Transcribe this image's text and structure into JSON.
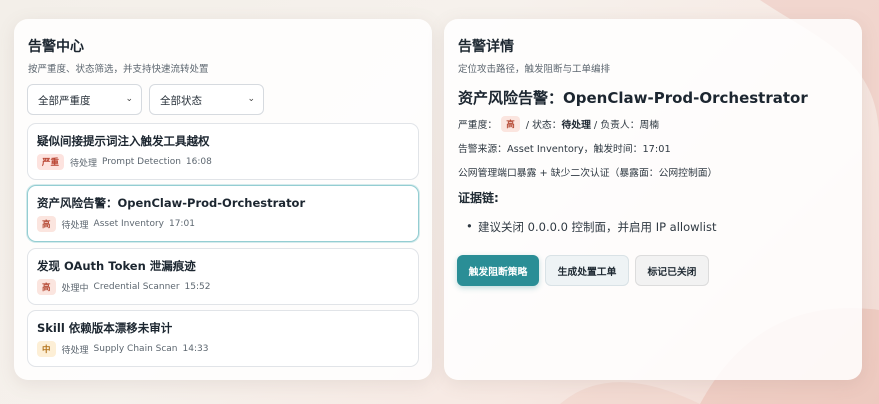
{
  "alert_center": {
    "title": "告警中心",
    "subtitle": "按严重度、状态筛选，并支持快速流转处置",
    "filters": {
      "severity": "全部严重度",
      "status": "全部状态"
    },
    "alerts": [
      {
        "title": "疑似间接提示词注入触发工具越权",
        "severity": "严重",
        "status": "待处理",
        "source": "Prompt Detection",
        "time": "16:08"
      },
      {
        "title": "资产风险告警：OpenClaw-Prod-Orchestrator",
        "severity": "高",
        "status": "待处理",
        "source": "Asset Inventory",
        "time": "17:01"
      },
      {
        "title": "发现 OAuth Token 泄漏痕迹",
        "severity": "高",
        "status": "处理中",
        "source": "Credential Scanner",
        "time": "15:52"
      },
      {
        "title": "Skill 依赖版本漂移未审计",
        "severity": "中",
        "status": "待处理",
        "source": "Supply Chain Scan",
        "time": "14:33"
      }
    ]
  },
  "detail": {
    "title": "告警详情",
    "subtitle": "定位攻击路径，触发阻断与工单编排",
    "heading": "资产风险告警：OpenClaw-Prod-Orchestrator",
    "severity_label": "严重度：",
    "severity": "高",
    "status_label": "/ 状态：",
    "status": "待处理",
    "owner_label": "/ 负责人：",
    "owner": "周楠",
    "source_line": "告警来源：Asset Inventory，触发时间：17:01",
    "description": "公网管理端口暴露 + 缺少二次认证（暴露面：公网控制面）",
    "evidence_title": "证据链:",
    "evidence": [
      "建议关闭 0.0.0.0 控制面，并启用 IP allowlist"
    ],
    "buttons": {
      "block": "触发阻断策略",
      "ticket": "生成处置工单",
      "close": "标记已关闭"
    }
  },
  "icons": {
    "select_chevron": "chevron-down-icon"
  },
  "colors": {
    "accent": "#2a8e96",
    "critical": "#b8412f",
    "medium": "#b3731a"
  }
}
